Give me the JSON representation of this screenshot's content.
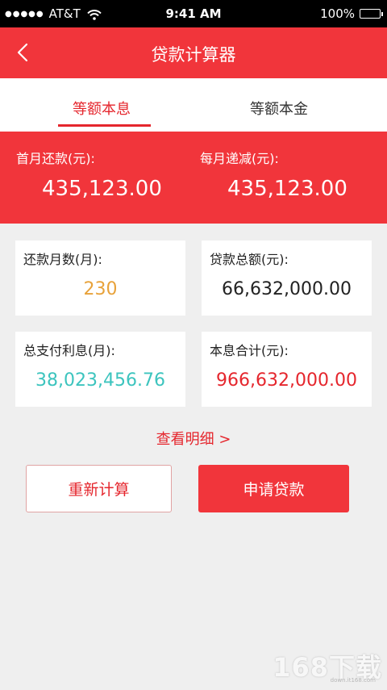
{
  "status_bar": {
    "carrier": "AT&T",
    "time": "9:41 AM",
    "battery": "100%",
    "signal_dots": "●●●●●"
  },
  "nav": {
    "title": "贷款计算器"
  },
  "tabs": [
    {
      "label": "等额本息",
      "active": true
    },
    {
      "label": "等额本金",
      "active": false
    }
  ],
  "summary": {
    "first_month_label": "首月还款(元):",
    "first_month_value": "435,123.00",
    "monthly_decrease_label": "每月递减(元):",
    "monthly_decrease_value": "435,123.00"
  },
  "cards": {
    "months": {
      "label": "还款月数(月):",
      "value": "230",
      "color": "#e8a23a"
    },
    "total_loan": {
      "label": "贷款总额(元):",
      "value": "66,632,000.00",
      "color": "#222222"
    },
    "total_interest": {
      "label": "总支付利息(月):",
      "value": "38,023,456.76",
      "color": "#3cc4be"
    },
    "total_sum": {
      "label": "本息合计(元):",
      "value": "966,632,000.00",
      "color": "#e5262d"
    }
  },
  "detail_link": "查看明细  >",
  "buttons": {
    "recalc": "重新计算",
    "apply": "申请贷款"
  },
  "watermark": {
    "main": "168下载",
    "sub": "down.it168.com"
  },
  "colors": {
    "primary": "#f1353b",
    "accent_text": "#e5262d",
    "background": "#efefef"
  }
}
